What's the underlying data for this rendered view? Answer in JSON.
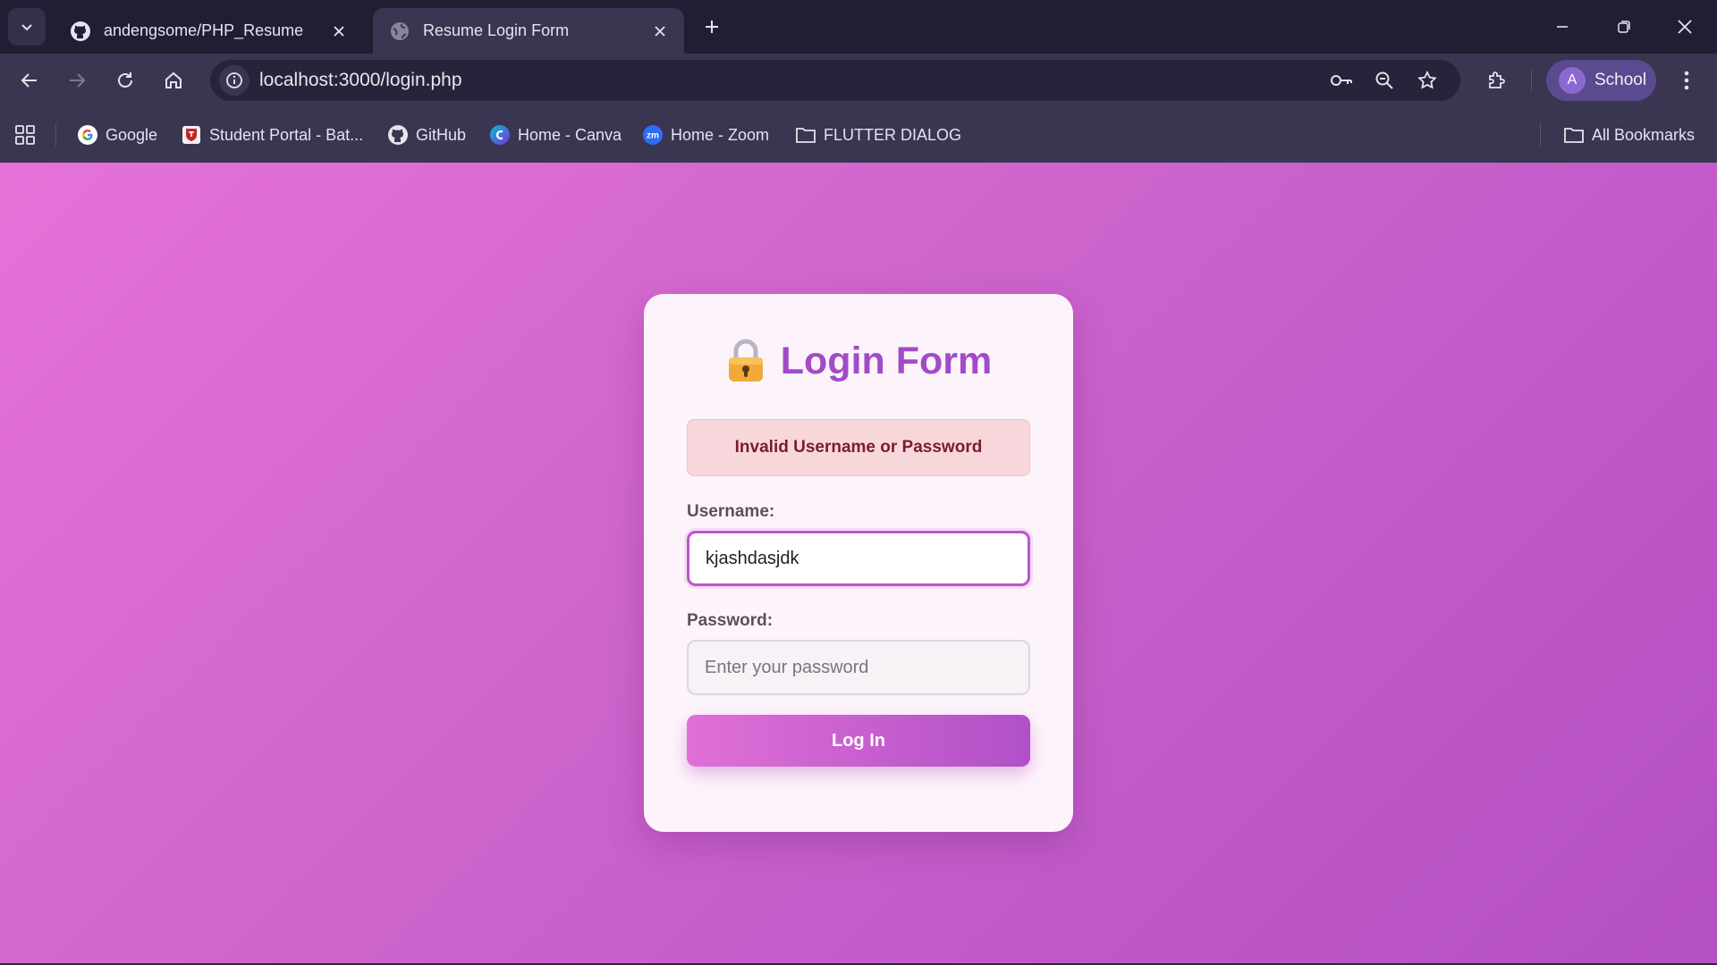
{
  "browser": {
    "tabs": [
      {
        "title": "andengsome/PHP_Resume",
        "active": false,
        "icon": "github-icon"
      },
      {
        "title": "Resume Login Form",
        "active": true,
        "icon": "globe-icon"
      }
    ],
    "url": "localhost:3000/login.php",
    "profile": {
      "initial": "A",
      "name": "School"
    }
  },
  "bookmarks": {
    "items": [
      {
        "label": "Google",
        "icon": "google-icon"
      },
      {
        "label": "Student Portal - Bat...",
        "icon": "shield-crest-icon"
      },
      {
        "label": "GitHub",
        "icon": "github-icon"
      },
      {
        "label": "Home - Canva",
        "icon": "canva-icon"
      },
      {
        "label": "Home - Zoom",
        "icon": "zoom-icon"
      },
      {
        "label": "FLUTTER DIALOG",
        "icon": "folder-icon"
      }
    ],
    "all_label": "All Bookmarks"
  },
  "form": {
    "title": "Login Form",
    "error": "Invalid Username or Password",
    "username_label": "Username:",
    "username_value": "kjashdasjdk",
    "password_label": "Password:",
    "password_placeholder": "Enter your password",
    "submit_label": "Log In"
  },
  "colors": {
    "accent": "#a24bc8",
    "page_gradient_start": "#e672d8",
    "page_gradient_end": "#b44fc4",
    "error_bg": "#f8d7dc",
    "error_text": "#7a1d2b"
  }
}
